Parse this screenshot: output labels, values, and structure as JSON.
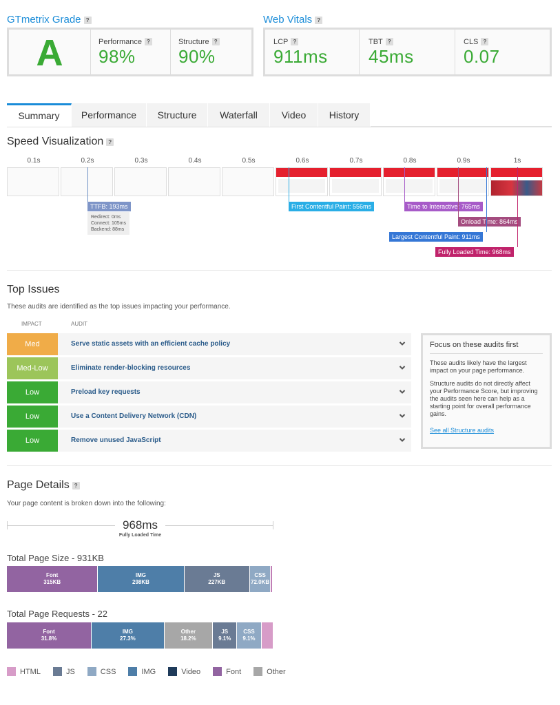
{
  "grade": {
    "title": "GTmetrix Grade",
    "letter": "A",
    "performance_label": "Performance",
    "performance_value": "98%",
    "structure_label": "Structure",
    "structure_value": "90%"
  },
  "vitals": {
    "title": "Web Vitals",
    "lcp_label": "LCP",
    "lcp_value": "911ms",
    "tbt_label": "TBT",
    "tbt_value": "45ms",
    "cls_label": "CLS",
    "cls_value": "0.07"
  },
  "help_glyph": "?",
  "tabs": [
    "Summary",
    "Performance",
    "Structure",
    "Waterfall",
    "Video",
    "History"
  ],
  "speed": {
    "title": "Speed Visualization",
    "ticks": [
      "0.1s",
      "0.2s",
      "0.3s",
      "0.4s",
      "0.5s",
      "0.6s",
      "0.7s",
      "0.8s",
      "0.9s",
      "1s"
    ],
    "ttfb": "TTFB: 193ms",
    "ttfb_details": [
      "Redirect: 0ms",
      "Connect: 105ms",
      "Backend: 88ms"
    ],
    "fcp": "First Contentful Paint: 556ms",
    "tti": "Time to Interactive: 765ms",
    "onload": "Onload Time: 864ms",
    "lcp": "Largest Contentful Paint: 911ms",
    "fully_loaded": "Fully Loaded Time: 968ms"
  },
  "issues": {
    "title": "Top Issues",
    "subtitle": "These audits are identified as the top issues impacting your performance.",
    "col_impact": "IMPACT",
    "col_audit": "AUDIT",
    "rows": [
      {
        "impact": "Med",
        "audit": "Serve static assets with an efficient cache policy",
        "color": "#f0ac48"
      },
      {
        "impact": "Med-Low",
        "audit": "Eliminate render-blocking resources",
        "color": "#9cc55a"
      },
      {
        "impact": "Low",
        "audit": "Preload key requests",
        "color": "#3aaa35"
      },
      {
        "impact": "Low",
        "audit": "Use a Content Delivery Network (CDN)",
        "color": "#3aaa35"
      },
      {
        "impact": "Low",
        "audit": "Remove unused JavaScript",
        "color": "#3aaa35"
      }
    ],
    "focus_title": "Focus on these audits first",
    "focus_p1": "These audits likely have the largest impact on your page performance.",
    "focus_p2": "Structure audits do not directly affect your Performance Score, but improving the audits seen here can help as a starting point for overall performance gains.",
    "focus_link": "See all Structure audits"
  },
  "details": {
    "title": "Page Details",
    "subtitle": "Your page content is broken down into the following:",
    "loaded_value": "968ms",
    "loaded_label": "Fully Loaded Time",
    "size_title": "Total Page Size - 931KB",
    "size_segments": [
      {
        "name": "Font",
        "value": "315KB",
        "kb": 315,
        "color": "#9264a1"
      },
      {
        "name": "IMG",
        "value": "298KB",
        "kb": 298,
        "color": "#4e7ea8"
      },
      {
        "name": "JS",
        "value": "227KB",
        "kb": 227,
        "color": "#6a7b94"
      },
      {
        "name": "CSS",
        "value": "72.0KB",
        "kb": 72,
        "color": "#8fa9c4"
      },
      {
        "name": "",
        "value": "",
        "kb": 6,
        "color": "#c07fb6"
      },
      {
        "name": "",
        "value": "",
        "kb": 3,
        "color": "#d79cc8"
      }
    ],
    "requests_title": "Total Page Requests - 22",
    "request_segments": [
      {
        "name": "Font",
        "value": "31.8%",
        "pct": 31.8,
        "color": "#9264a1"
      },
      {
        "name": "IMG",
        "value": "27.3%",
        "pct": 27.3,
        "color": "#4e7ea8"
      },
      {
        "name": "Other",
        "value": "18.2%",
        "pct": 18.2,
        "color": "#a7a7a7"
      },
      {
        "name": "JS",
        "value": "9.1%",
        "pct": 9.1,
        "color": "#6a7b94"
      },
      {
        "name": "CSS",
        "value": "9.1%",
        "pct": 9.1,
        "color": "#8fa9c4"
      },
      {
        "name": "",
        "value": "",
        "pct": 4.5,
        "color": "#d79cc8"
      }
    ],
    "legend": [
      {
        "name": "HTML",
        "color": "#d79cc8"
      },
      {
        "name": "JS",
        "color": "#6a7b94"
      },
      {
        "name": "CSS",
        "color": "#8fa9c4"
      },
      {
        "name": "IMG",
        "color": "#4e7ea8"
      },
      {
        "name": "Video",
        "color": "#1f3b5a"
      },
      {
        "name": "Font",
        "color": "#9264a1"
      },
      {
        "name": "Other",
        "color": "#a7a7a7"
      }
    ]
  }
}
